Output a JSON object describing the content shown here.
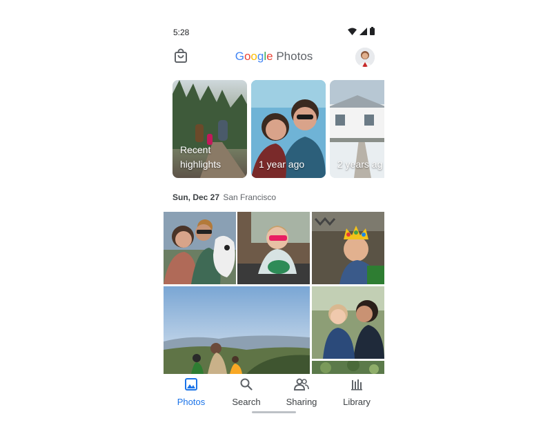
{
  "status_bar": {
    "time": "5:28"
  },
  "app_bar": {
    "title_google": [
      "G",
      "o",
      "o",
      "g",
      "l",
      "e"
    ],
    "title_photos": "Photos"
  },
  "memories": [
    {
      "line1": "Recent",
      "line2": "highlights"
    },
    {
      "line1": "1 year ago",
      "line2": ""
    },
    {
      "line1": "2 years ag",
      "line2": ""
    }
  ],
  "section": {
    "date": "Sun, Dec 27",
    "location": "San Francisco"
  },
  "bottom_nav": [
    {
      "label": "Photos",
      "icon": "photo-icon",
      "active": true
    },
    {
      "label": "Search",
      "icon": "search-icon",
      "active": false
    },
    {
      "label": "Sharing",
      "icon": "people-icon",
      "active": false
    },
    {
      "label": "Library",
      "icon": "library-icon",
      "active": false
    }
  ],
  "colors": {
    "accent": "#1a73e8"
  }
}
